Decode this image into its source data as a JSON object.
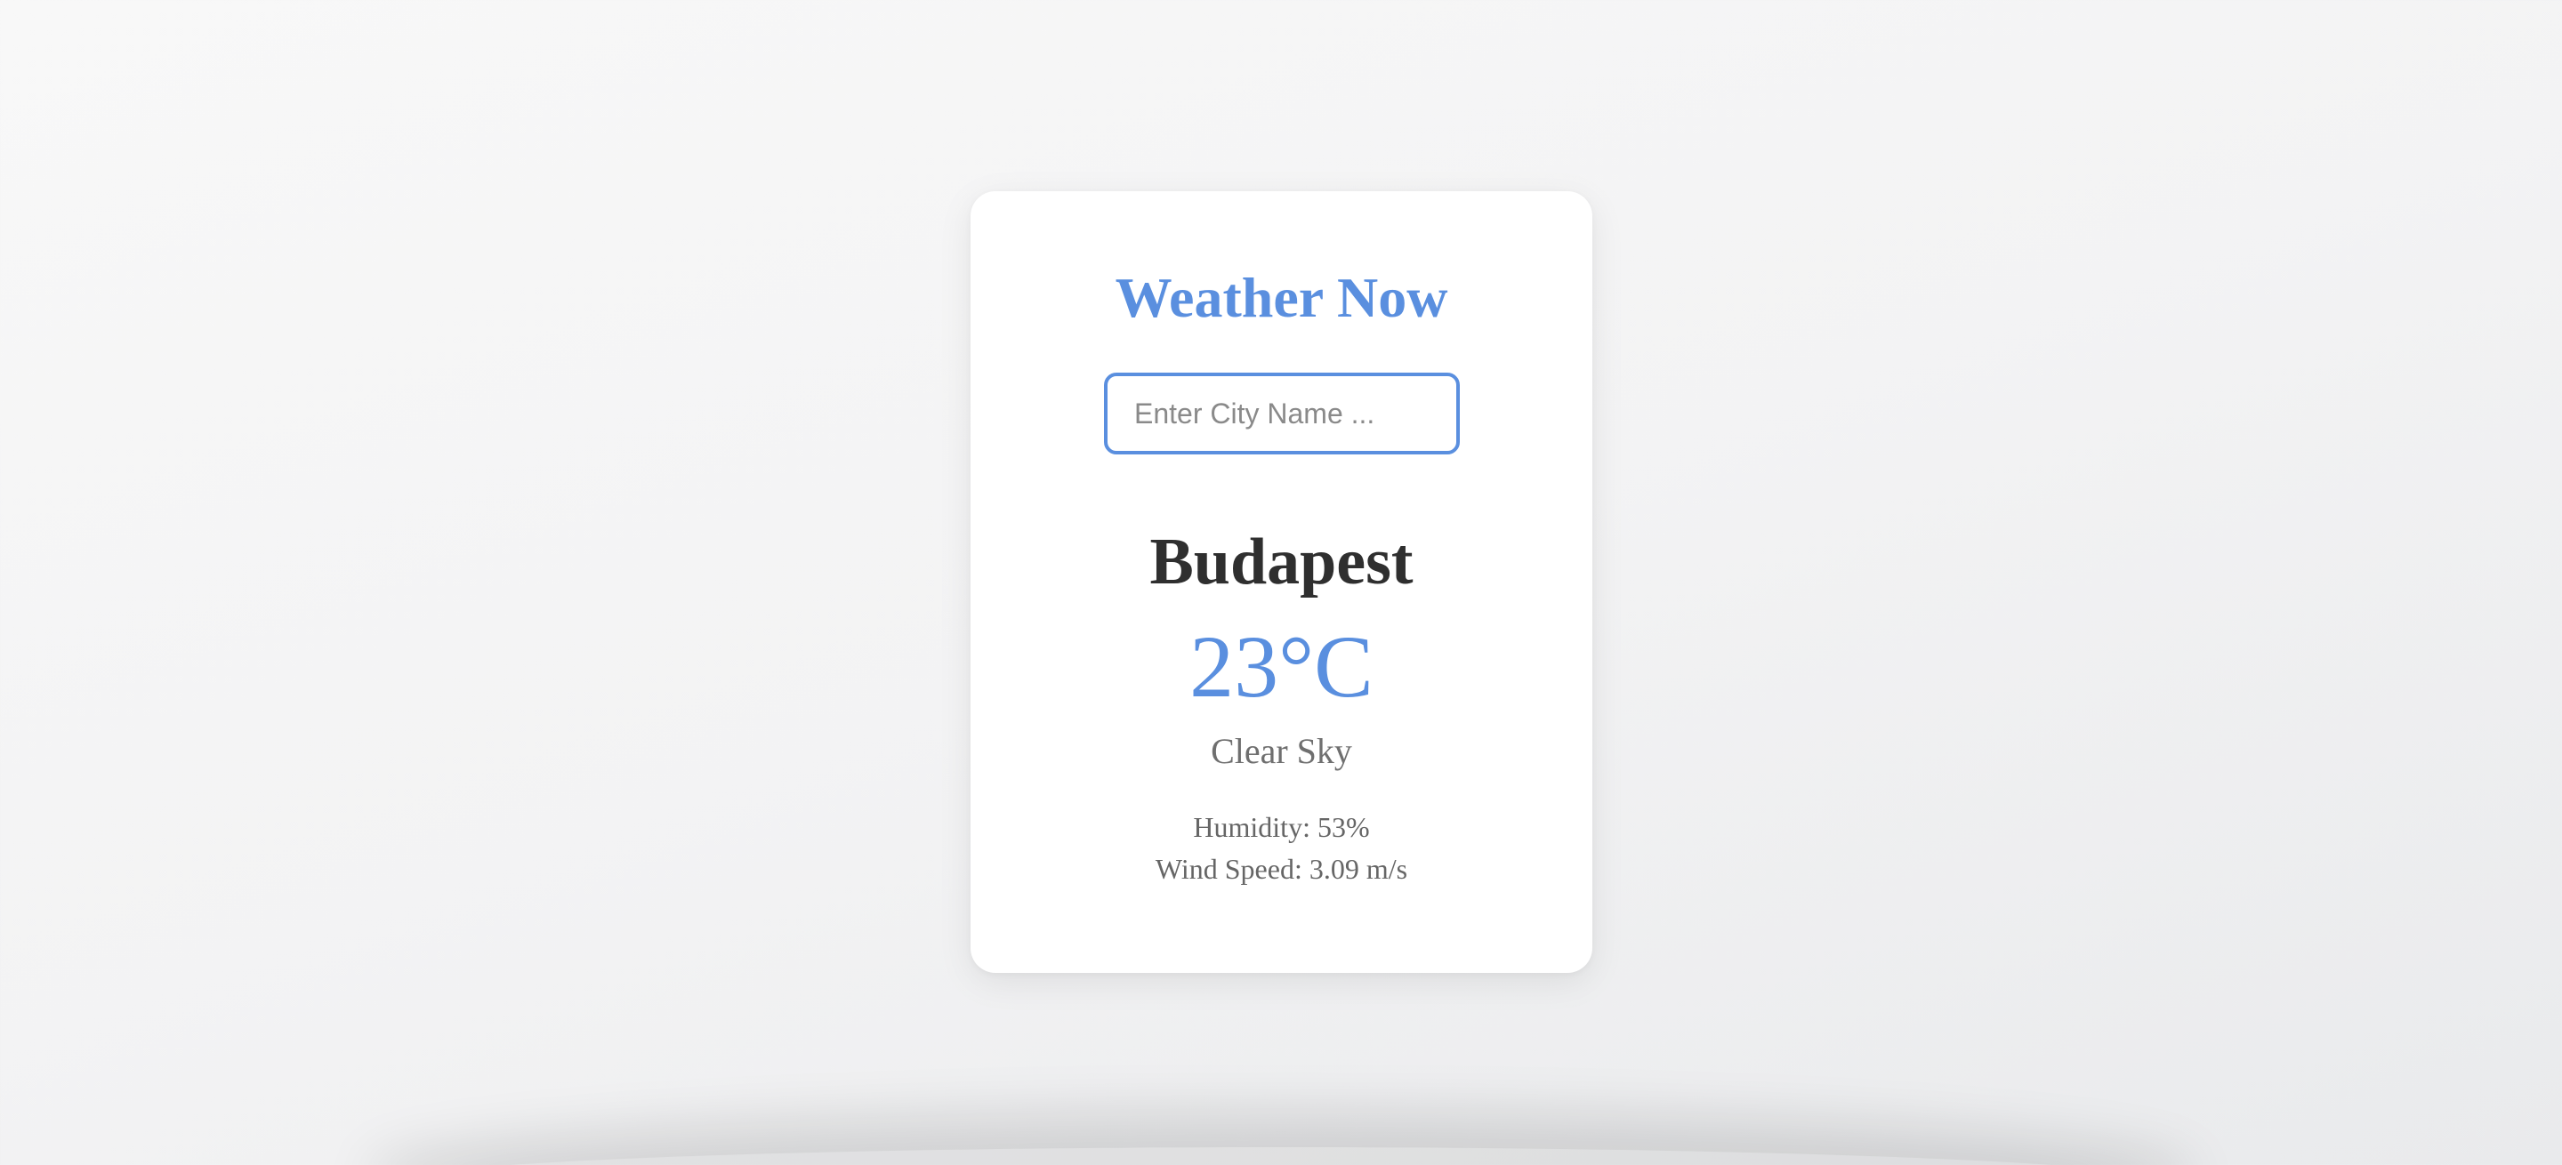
{
  "app": {
    "title": "Weather Now"
  },
  "search": {
    "placeholder": "Enter City Name ...",
    "value": ""
  },
  "weather": {
    "city": "Budapest",
    "temperature": "23°C",
    "description": "Clear Sky",
    "humidity": "Humidity: 53%",
    "wind_speed": "Wind Speed: 3.09 m/s"
  },
  "colors": {
    "accent": "#5a8fdf",
    "city_text": "#2f2f2f",
    "muted_text": "#6f6f6f",
    "card_bg": "#ffffff",
    "page_bg": "#f3f3f4"
  }
}
